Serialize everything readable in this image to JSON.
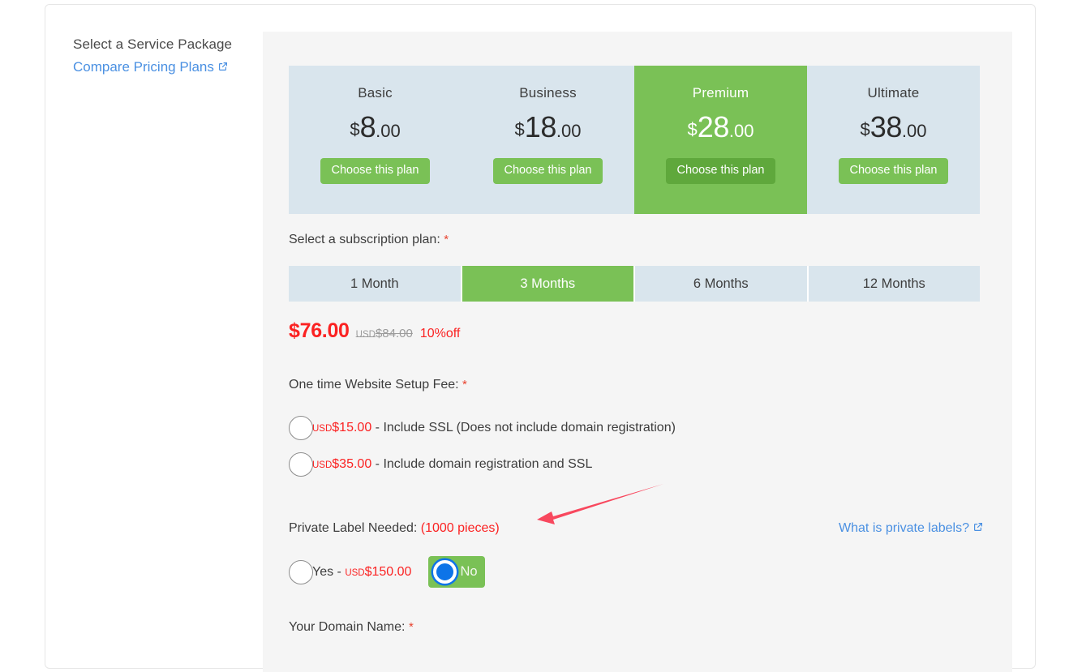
{
  "sidebar": {
    "title": "Select a Service Package",
    "compare_link": "Compare Pricing Plans",
    "compare_icon": "external-link-icon"
  },
  "plans": {
    "choose_label": "Choose this plan",
    "items": [
      {
        "name": "Basic",
        "currency": "$",
        "integer": "8",
        "decimal": ".00",
        "featured": false
      },
      {
        "name": "Business",
        "currency": "$",
        "integer": "18",
        "decimal": ".00",
        "featured": false
      },
      {
        "name": "Premium",
        "currency": "$",
        "integer": "28",
        "decimal": ".00",
        "featured": true
      },
      {
        "name": "Ultimate",
        "currency": "$",
        "integer": "38",
        "decimal": ".00",
        "featured": false
      }
    ]
  },
  "subscription": {
    "label": "Select a subscription plan:",
    "required_mark": "*",
    "options": [
      {
        "label": "1 Month",
        "active": false
      },
      {
        "label": "3 Months",
        "active": true
      },
      {
        "label": "6 Months",
        "active": false
      },
      {
        "label": "12 Months",
        "active": false
      }
    ],
    "price_now": "$76.00",
    "price_old_currency": "USD",
    "price_old_amount": "$84.00",
    "discount": "10%off"
  },
  "setup_fee": {
    "label": "One time Website Setup Fee:",
    "required_mark": "*",
    "options": [
      {
        "currency": "USD",
        "amount": "$15.00",
        "description": " - Include SSL (Does not include domain registration)",
        "selected": false
      },
      {
        "currency": "USD",
        "amount": "$35.00",
        "description": " - Include domain registration and SSL",
        "selected": false
      }
    ]
  },
  "private_label": {
    "label": "Private Label Needed:",
    "pieces": "(1000 pieces)",
    "help_link": "What is private labels?",
    "help_icon": "external-link-icon",
    "yes_text": "Yes - ",
    "yes_currency": "USD",
    "yes_amount": "$150.00",
    "no_label": "No",
    "selected": "No"
  },
  "domain": {
    "label": "Your Domain Name:",
    "required_mark": "*"
  },
  "annotation": {
    "type": "red-arrow",
    "color": "#f8485e",
    "points_to": "private-label-pieces"
  },
  "colors": {
    "accent_green": "#7ac156",
    "featured_button_green": "#5fa83c",
    "light_blue": "#d9e5ed",
    "red": "#fb2222",
    "link_blue": "#4a90e2",
    "panel_gray": "#f5f5f5",
    "radio_blue": "#0d74e8"
  }
}
